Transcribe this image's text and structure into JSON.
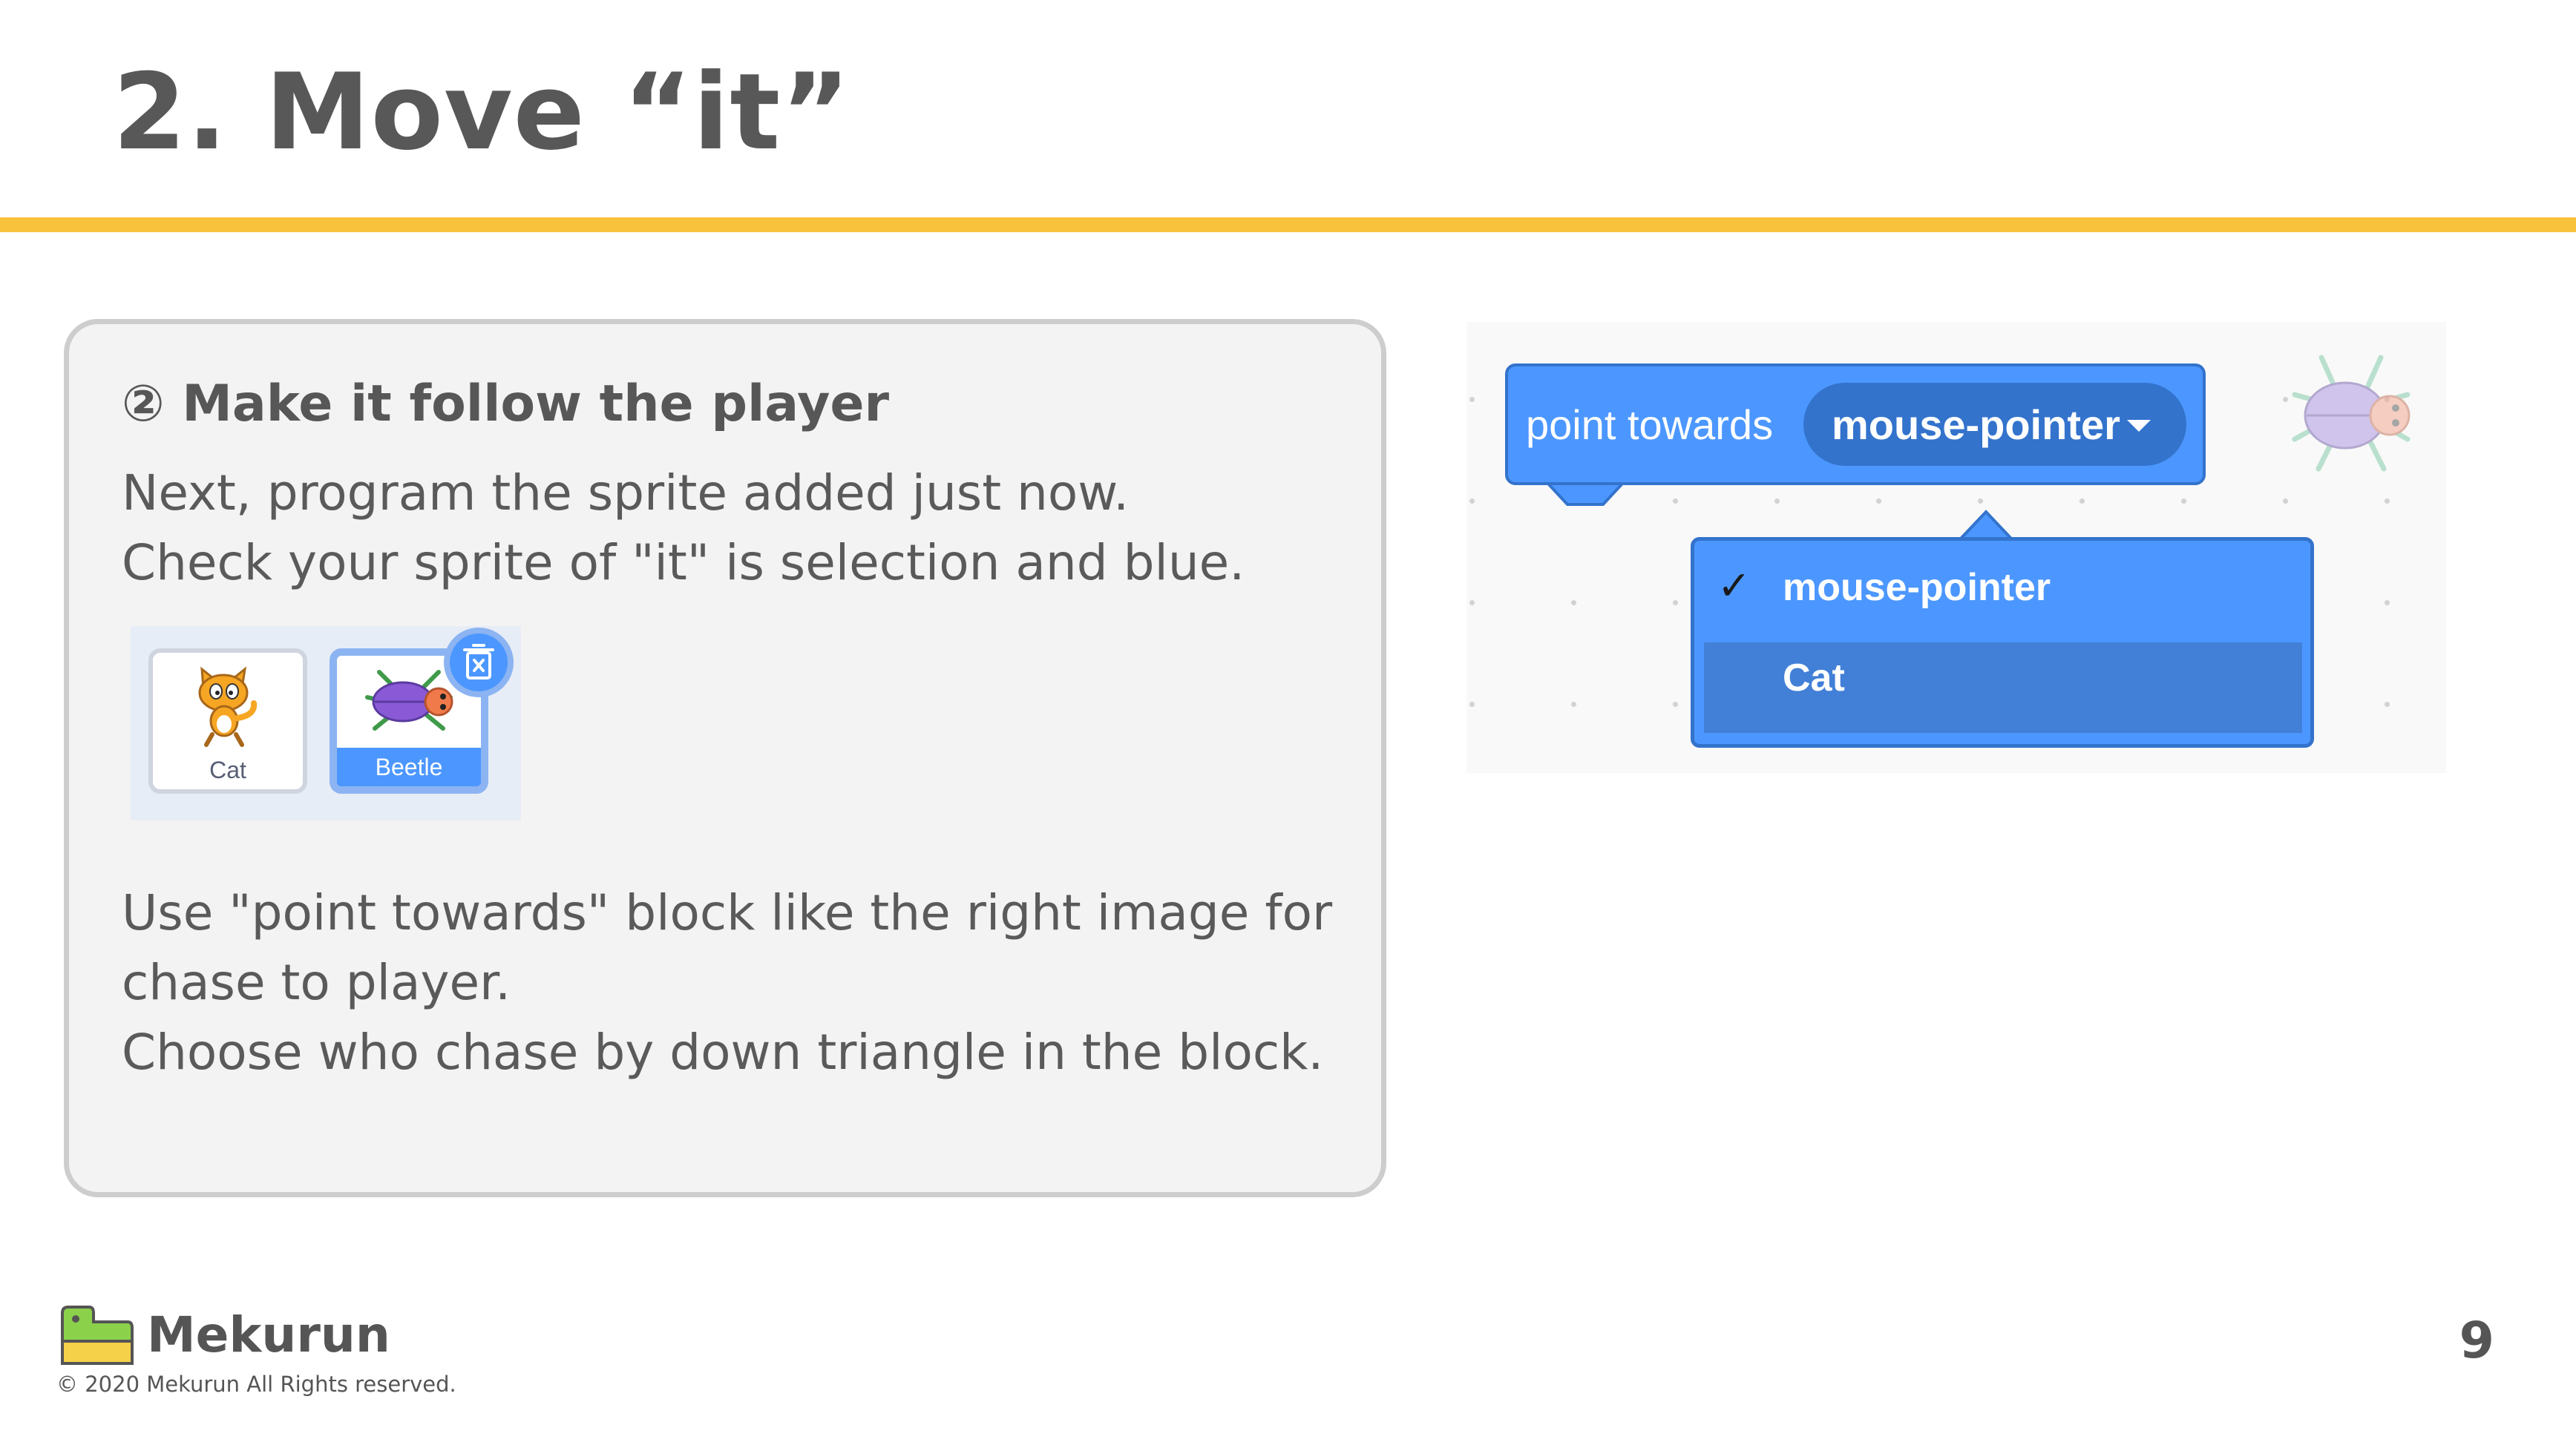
{
  "title": "2. Move “it”",
  "card": {
    "step_heading": "② Make it follow the player",
    "intro_lines": [
      "Next, program the sprite added just now.",
      "Check your sprite of \"it\" is selection and blue."
    ],
    "sprites": [
      {
        "name": "Cat",
        "selected": false
      },
      {
        "name": "Beetle",
        "selected": true
      }
    ],
    "body_lines": [
      "Use \"point towards\" block like the right image for",
      "chase to player.",
      "Choose who chase by down triangle in the block."
    ]
  },
  "block_panel": {
    "block_label": "point towards",
    "dropdown_value": "mouse-pointer",
    "menu_items": [
      {
        "label": "mouse-pointer",
        "checked": true
      },
      {
        "label": "Cat",
        "checked": false
      }
    ],
    "check_mark": "✓"
  },
  "colors": {
    "accent_rule": "#f9c23c",
    "block_blue": "#4c97ff",
    "block_dark_blue": "#3373cc"
  },
  "footer": {
    "brand": "Mekurun",
    "copyright": "© 2020 Mekurun All Rights reserved.",
    "page_number": "9"
  }
}
